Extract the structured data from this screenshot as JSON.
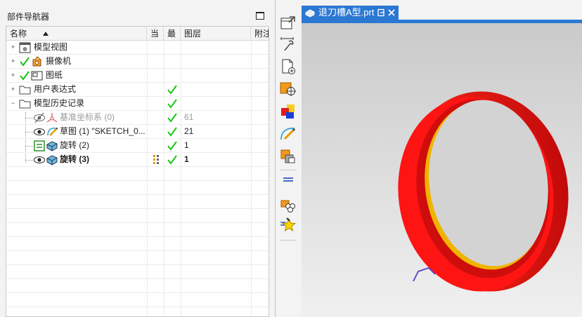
{
  "navigator": {
    "title": "部件导航器",
    "columns": {
      "name": "名称",
      "current": "当",
      "latest": "最",
      "layer": "图层",
      "comment": "附注"
    },
    "rows": [
      {
        "label": "模型视图",
        "layer": ""
      },
      {
        "label": "摄像机",
        "layer": ""
      },
      {
        "label": "图纸",
        "layer": ""
      },
      {
        "label": "用户表达式",
        "layer": ""
      },
      {
        "label": "模型历史记录",
        "layer": ""
      },
      {
        "label": "基准坐标系 (0)",
        "layer": "61"
      },
      {
        "label": "草图 (1) \"SKETCH_0...",
        "layer": "21"
      },
      {
        "label": "旋转 (2)",
        "layer": "1"
      },
      {
        "label": "旋转 (3)",
        "layer": "1"
      }
    ]
  },
  "viewport": {
    "tab_title": "退刀槽A型.prt"
  },
  "icons": [
    "maximize-icon",
    "expand-icon",
    "collapse-icon",
    "check-icon",
    "view-icon",
    "camera-icon",
    "drawing-icon",
    "folder-icon",
    "eye-icon",
    "eye-hidden-icon",
    "datum-csys-icon",
    "sketch-icon",
    "revolve-icon",
    "dependency-icon",
    "part-file-icon",
    "unpin-icon",
    "close-icon"
  ],
  "colors": {
    "accent": "#2b78d3",
    "check": "#17c617",
    "model": "#ee1010",
    "model_inner": "#f0b400"
  }
}
